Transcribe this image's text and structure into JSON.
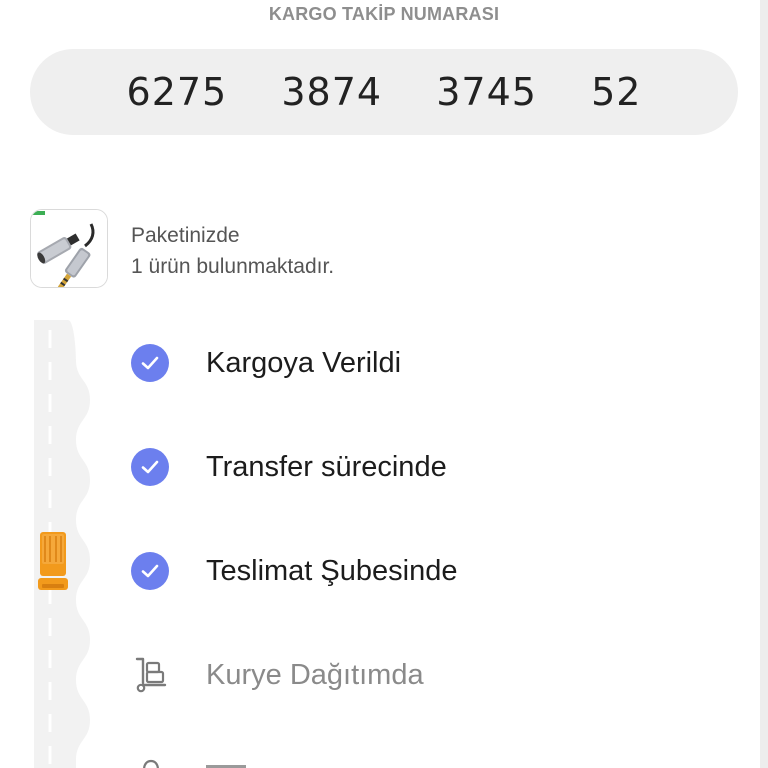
{
  "tracking": {
    "label": "KARGO TAKİP NUMARASI",
    "number": "6275  3874  3745  52"
  },
  "package": {
    "line1": "Paketinizde",
    "line2": "1 ürün bulunmaktadır."
  },
  "steps": [
    {
      "label": "Kargoya Verildi",
      "status": "done",
      "icon": "check-icon"
    },
    {
      "label": "Transfer sürecinde",
      "status": "done",
      "icon": "check-icon"
    },
    {
      "label": "Teslimat Şubesinde",
      "status": "done",
      "icon": "check-icon"
    },
    {
      "label": "Kurye Dağıtımda",
      "status": "pending",
      "icon": "hand-truck-icon"
    }
  ],
  "colors": {
    "accent": "#6c7fee",
    "truck": "#f29a1c",
    "pill_bg": "#efefef",
    "road": "#f2f2f2"
  }
}
